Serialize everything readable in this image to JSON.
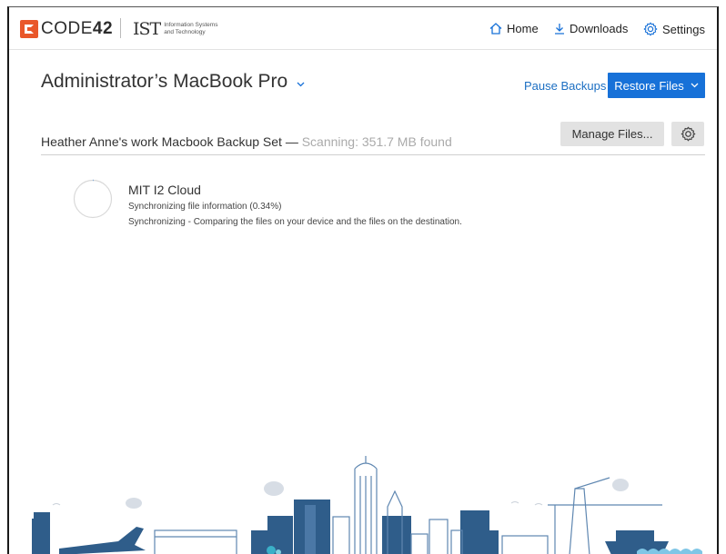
{
  "brand": {
    "logo_text_light": "CODE",
    "logo_text_bold": "42",
    "ist_mark": "IST",
    "ist_text": "Information Systems and Technology"
  },
  "nav": {
    "home": "Home",
    "downloads": "Downloads",
    "settings": "Settings"
  },
  "device": {
    "title": "Administrator’s MacBook Pro"
  },
  "actions": {
    "pause": "Pause Backups",
    "restore": "Restore Files"
  },
  "backup_set": {
    "name": "Heather Anne's work Macbook Backup Set —",
    "status": "Scanning: 351.7 MB found",
    "manage": "Manage Files..."
  },
  "destination": {
    "name": "MIT I2 Cloud",
    "line1": "Synchronizing file information (0.34%)",
    "line2": "Synchronizing - Comparing the files on your device and the files on the destination.",
    "progress_percent": 0.34
  },
  "colors": {
    "brand_orange": "#e9572a",
    "accent_blue": "#1771d8",
    "link_blue": "#1b6ec2",
    "skyline_blue": "#2f5d8a"
  }
}
